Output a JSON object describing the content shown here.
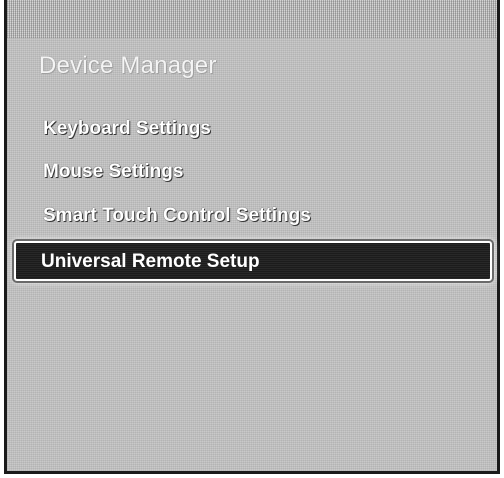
{
  "panel": {
    "title": "Device Manager"
  },
  "menu": {
    "items": [
      {
        "label": "Keyboard Settings"
      },
      {
        "label": "Mouse Settings"
      },
      {
        "label": "Smart Touch Control Settings"
      },
      {
        "label": "Universal Remote Setup",
        "selected": true
      }
    ]
  },
  "colors": {
    "background": "#c9c9c9",
    "selected_background": "#1c1c1c",
    "selected_border": "#ffffff",
    "text": "#ffffff"
  }
}
